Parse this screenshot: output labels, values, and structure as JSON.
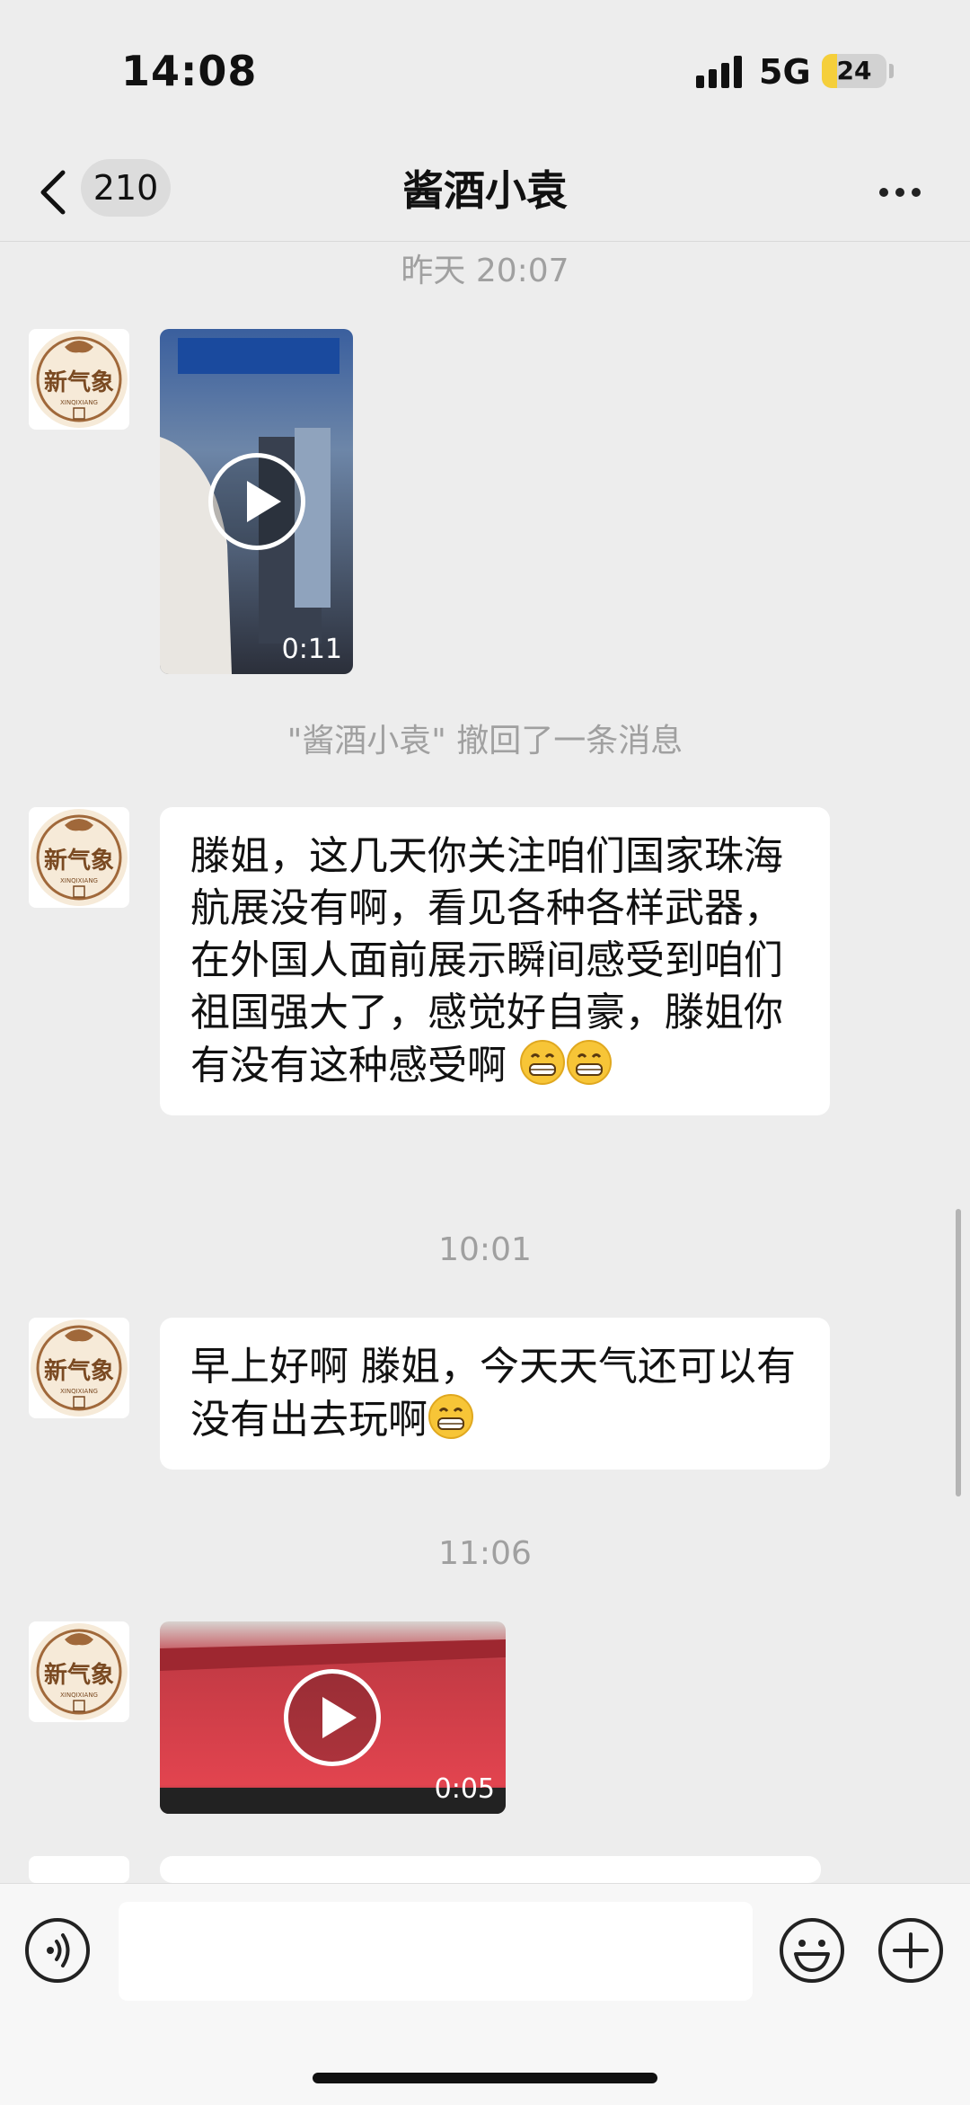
{
  "status_bar": {
    "time": "14:08",
    "network": "5G",
    "battery": "24",
    "battery_level": 0.24
  },
  "nav": {
    "back_count": "210",
    "title": "酱酒小袁",
    "more_icon": "more-dots-icon"
  },
  "chat": {
    "ts1": "昨天 20:07",
    "video1_duration": "0:11",
    "recall_notice": "\"酱酒小袁\" 撤回了一条消息",
    "msg1_text": "滕姐，这几天你关注咱们国家珠海航展没有啊，看见各种各样武器，在外国人面前展示瞬间感受到咱们祖国强大了，感觉好自豪，滕姐你有没有这种感受啊",
    "ts2": "10:01",
    "msg2_text": "早上好啊 滕姐，今天天气还可以有没有出去玩啊",
    "ts3": "11:06",
    "video2_duration": "0:05",
    "avatar_text": "新气象",
    "avatar_sub": "XINQIXIANG"
  },
  "input_bar": {
    "voice_icon": "voice-icon",
    "emoji_icon": "emoji-icon",
    "plus_icon": "plus-icon"
  },
  "colors": {
    "background": "#ededed",
    "bubble": "#ffffff",
    "avatar_brown": "#8a5a2e",
    "battery": "#f5cf3b"
  }
}
